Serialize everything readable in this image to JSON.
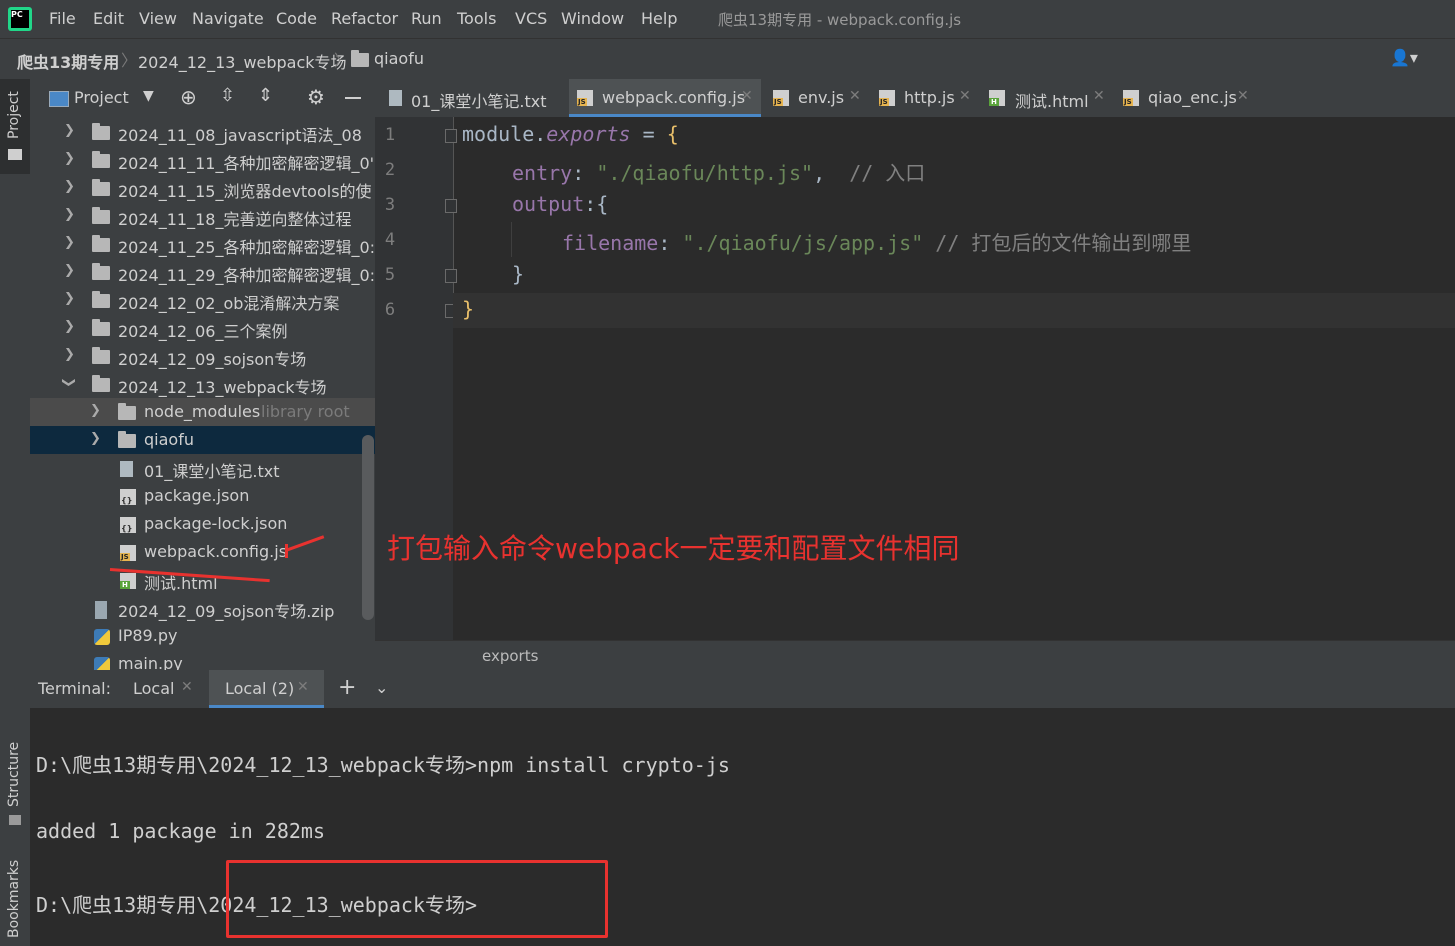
{
  "menubar": {
    "logo_text": "PC",
    "items": [
      "File",
      "Edit",
      "View",
      "Navigate",
      "Code",
      "Refactor",
      "Run",
      "Tools",
      "VCS",
      "Window",
      "Help"
    ],
    "window_title": "爬虫13期专用 - webpack.config.js"
  },
  "navbar": {
    "crumbs": [
      "爬虫13期专用",
      "2024_12_13_webpack专场",
      "qiaofu"
    ]
  },
  "left_stripe": {
    "project_label": "Project",
    "structure_label": "Structure",
    "bookmarks_label": "Bookmarks"
  },
  "project": {
    "title": "Project",
    "tree": [
      {
        "label": "2024_11_08_javascript语法_08",
        "type": "folder",
        "depth": 0,
        "expanded": false
      },
      {
        "label": "2024_11_11_各种加密解密逻辑_0'",
        "type": "folder",
        "depth": 0,
        "expanded": false
      },
      {
        "label": "2024_11_15_浏览器devtools的使",
        "type": "folder",
        "depth": 0,
        "expanded": false
      },
      {
        "label": "2024_11_18_完善逆向整体过程",
        "type": "folder",
        "depth": 0,
        "expanded": false
      },
      {
        "label": "2024_11_25_各种加密解密逻辑_0:",
        "type": "folder",
        "depth": 0,
        "expanded": false
      },
      {
        "label": "2024_11_29_各种加密解密逻辑_0:",
        "type": "folder",
        "depth": 0,
        "expanded": false
      },
      {
        "label": "2024_12_02_ob混淆解决方案",
        "type": "folder",
        "depth": 0,
        "expanded": false
      },
      {
        "label": "2024_12_06_三个案例",
        "type": "folder",
        "depth": 0,
        "expanded": false
      },
      {
        "label": "2024_12_09_sojson专场",
        "type": "folder",
        "depth": 0,
        "expanded": false
      },
      {
        "label": "2024_12_13_webpack专场",
        "type": "folder",
        "depth": 0,
        "expanded": true
      },
      {
        "label": "node_modules",
        "suffix": "library root",
        "type": "folder",
        "depth": 1,
        "expanded": false
      },
      {
        "label": "qiaofu",
        "type": "folder",
        "depth": 1,
        "expanded": false
      },
      {
        "label": "01_课堂小笔记.txt",
        "type": "txt",
        "depth": 1
      },
      {
        "label": "package.json",
        "type": "json",
        "depth": 1
      },
      {
        "label": "package-lock.json",
        "type": "json",
        "depth": 1
      },
      {
        "label": "webpack.config.js",
        "type": "js",
        "depth": 1
      },
      {
        "label": "测试.html",
        "type": "html",
        "depth": 1
      },
      {
        "label": "2024_12_09_sojson专场.zip",
        "type": "zip",
        "depth": 0
      },
      {
        "label": "IP89.py",
        "type": "py",
        "depth": 0
      },
      {
        "label": "main.py",
        "type": "py",
        "depth": 0
      }
    ]
  },
  "editor": {
    "tabs": [
      {
        "label": "01_课堂小笔记.txt",
        "type": "txt",
        "active": false
      },
      {
        "label": "webpack.config.js",
        "type": "js",
        "active": true
      },
      {
        "label": "env.js",
        "type": "js",
        "active": false
      },
      {
        "label": "http.js",
        "type": "js",
        "active": false
      },
      {
        "label": "测试.html",
        "type": "html",
        "active": false
      },
      {
        "label": "qiao_enc.js",
        "type": "js",
        "active": false
      }
    ],
    "line_numbers": [
      "1",
      "2",
      "3",
      "4",
      "5",
      "6"
    ],
    "code": {
      "l1_module": "module",
      "l1_dot": ".",
      "l1_exports": "exports",
      "l1_eq": " = ",
      "l1_brace": "{",
      "l2_key": "entry",
      "l2_colon": ": ",
      "l2_str": "\"./qiaofu/http.js\"",
      "l2_comma": ",  ",
      "l2_cmt": "// 入口",
      "l3_key": "output",
      "l3_rest": ":{",
      "l4_key": "filename",
      "l4_colon": ": ",
      "l4_str": "\"./qiaofu/js/app.js\"",
      "l4_sp": " ",
      "l4_cmt": "// 打包后的文件输出到哪里",
      "l5": "}",
      "l6": "}"
    },
    "annotation": "打包输入命令webpack一定要和配置文件相同",
    "breadcrumb": "exports"
  },
  "terminal": {
    "label": "Terminal:",
    "tabs": [
      {
        "label": "Local",
        "active": false
      },
      {
        "label": "Local (2)",
        "active": true
      }
    ],
    "lines": [
      "D:\\爬虫13期专用\\2024_12_13_webpack专场>npm install crypto-js",
      "added 1 package in 282ms",
      "D:\\爬虫13期专用\\2024_12_13_webpack专场>"
    ]
  },
  "colors": {
    "annotation_red": "#e8322f",
    "selection_blue": "#0d293e",
    "accent": "#4a88c7"
  }
}
